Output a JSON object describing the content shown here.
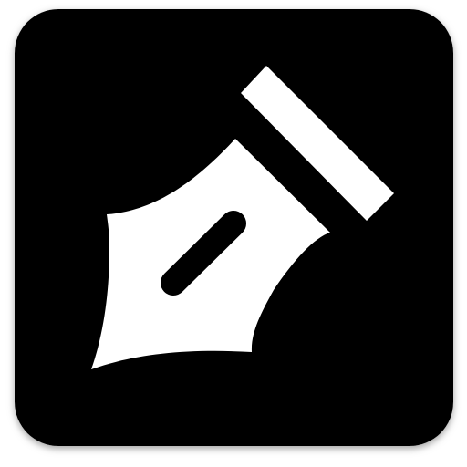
{
  "icon": {
    "name": "fountain-pen-nib-icon",
    "background_color": "#000000",
    "glyph_color": "#ffffff",
    "page_background": "#ffffff",
    "shadow_color": "#9a9a9a"
  }
}
